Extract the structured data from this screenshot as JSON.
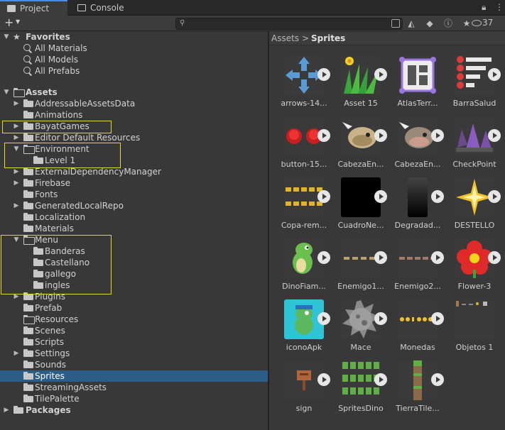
{
  "tabs": [
    {
      "label": "Project",
      "active": true
    },
    {
      "label": "Console",
      "active": false
    }
  ],
  "toolbar": {
    "add_label": "+",
    "search_placeholder": "",
    "hidden_count": "37"
  },
  "tree": {
    "favorites": {
      "label": "Favorites",
      "items": [
        "All Materials",
        "All Models",
        "All Prefabs"
      ]
    },
    "assets": {
      "label": "Assets",
      "items": [
        {
          "label": "AddressableAssetsData"
        },
        {
          "label": "Animations"
        },
        {
          "label": "BayatGames"
        },
        {
          "label": "Editor Default Resources"
        },
        {
          "label": "Environment"
        },
        {
          "label": "Level 1"
        },
        {
          "label": "ExternalDependencyManager"
        },
        {
          "label": "Firebase"
        },
        {
          "label": "Fonts"
        },
        {
          "label": "GeneratedLocalRepo"
        },
        {
          "label": "Localization"
        },
        {
          "label": "Materials"
        },
        {
          "label": "Menu"
        },
        {
          "label": "Banderas"
        },
        {
          "label": "Castellano"
        },
        {
          "label": "gallego"
        },
        {
          "label": "ingles"
        },
        {
          "label": "Plugins"
        },
        {
          "label": "Prefab"
        },
        {
          "label": "Resources"
        },
        {
          "label": "Scenes"
        },
        {
          "label": "Scripts"
        },
        {
          "label": "Settings"
        },
        {
          "label": "Sounds"
        },
        {
          "label": "Sprites"
        },
        {
          "label": "StreamingAssets"
        },
        {
          "label": "TilePalette"
        }
      ]
    },
    "packages": {
      "label": "Packages"
    }
  },
  "breadcrumb": {
    "root": "Assets",
    "separator": ">",
    "current": "Sprites"
  },
  "grid": [
    {
      "name": "arrows-14..."
    },
    {
      "name": "Asset 15"
    },
    {
      "name": "AtlasTerr..."
    },
    {
      "name": "BarraSalud"
    },
    {
      "name": "button-15..."
    },
    {
      "name": "CabezaEn..."
    },
    {
      "name": "CabezaEn..."
    },
    {
      "name": "CheckPoint"
    },
    {
      "name": "Copa-rem..."
    },
    {
      "name": "CuadroNe..."
    },
    {
      "name": "Degradad..."
    },
    {
      "name": "DESTELLO"
    },
    {
      "name": "DinoFiam..."
    },
    {
      "name": "Enemigo1..."
    },
    {
      "name": "Enemigo2..."
    },
    {
      "name": "Flower-3"
    },
    {
      "name": "iconoApk"
    },
    {
      "name": "Mace"
    },
    {
      "name": "Monedas"
    },
    {
      "name": "Objetos 1"
    },
    {
      "name": "sign"
    },
    {
      "name": "SpritesDino"
    },
    {
      "name": "TierraTile..."
    }
  ],
  "colors": {
    "selection": "#2c5d87",
    "highlight_box": "#e6d92a",
    "tab_accent": "#4a90e2"
  }
}
